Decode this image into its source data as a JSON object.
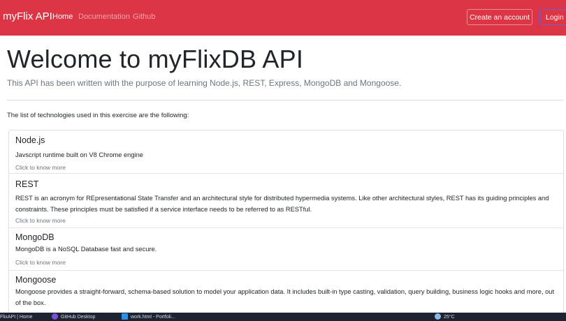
{
  "navbar": {
    "brand": "myFlix API",
    "links": [
      {
        "label": "Home",
        "active": true
      },
      {
        "label": "Documentation",
        "active": false
      },
      {
        "label": "Github",
        "active": false
      }
    ],
    "create_account_label": "Create an account",
    "login_label": "Login"
  },
  "colors": {
    "navbar_bg": "#dc3545",
    "text": "#212529",
    "muted": "#6c757d"
  },
  "main": {
    "title": "Welcome to myFlixDB API",
    "lead": "This API has been written with the purpose of learning Node.js, REST, Express, MongoDB and Mongoose.",
    "intro": "The list of technologies used in this exercise are the following:",
    "technologies": [
      {
        "name": "Node.js",
        "description": "Javscript runtime built on V8 Chrome engine",
        "more": "Click to know more"
      },
      {
        "name": "REST",
        "description": "REST is an acronym for REpresentational State Transfer and an architectural style for distributed hypermedia systems. Like other architectural styles, REST has its guiding principles and constraints. These principles must be satisfied if a service interface needs to be referred to as RESTful.",
        "more": "Click to know more"
      },
      {
        "name": "MongoDB",
        "description": "MongoDB is a NoSQL Database fast and secure.",
        "more": "Click to know more"
      },
      {
        "name": "Mongoose",
        "description": "Mongoose provides a straight-forward, schema-based solution to model your application data. It includes built-in type casting, validation, query building, business logic hooks and more, out of the box.",
        "more": ""
      }
    ]
  },
  "taskbar": {
    "items": [
      {
        "label": "FlixAPI | Home",
        "icon": "browser-icon"
      },
      {
        "label": "GitHub Desktop",
        "icon": "github-desktop-icon"
      },
      {
        "label": "work.html - Portfoli...",
        "icon": "vscode-icon"
      },
      {
        "label": "25°C",
        "icon": "weather-icon"
      }
    ]
  }
}
